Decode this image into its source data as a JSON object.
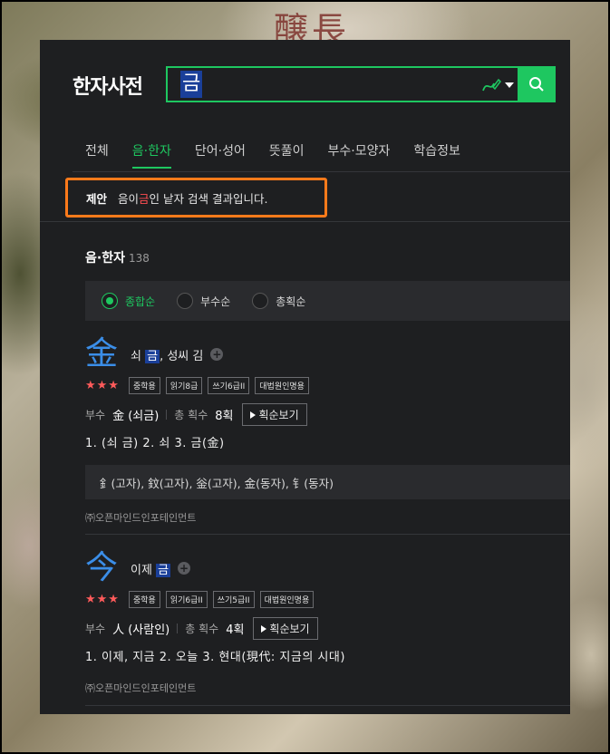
{
  "header": {
    "logo": "한자사전",
    "search_value": "금"
  },
  "tabs": [
    "전체",
    "음·한자",
    "단어·성어",
    "뜻풀이",
    "부수·모양자",
    "학습정보"
  ],
  "suggest": {
    "tag": "제안",
    "text_before": "음이 ",
    "highlight": "금",
    "text_after": "인 낱자 검색 결과입니다."
  },
  "section": {
    "title": "음·한자",
    "count": "138"
  },
  "sort": [
    "종합순",
    "부수순",
    "총획순"
  ],
  "entries": [
    {
      "hanja": "金",
      "meaning_pre": "쇠 ",
      "meaning_hl": "금",
      "meaning_post": ", 성씨 김",
      "stars": "★★★",
      "badges": [
        "중학용",
        "읽기8급",
        "쓰기6급II",
        "대법원인명용"
      ],
      "radical_label": "부수",
      "radical_value": "金 (쇠금)",
      "strokes_label": "총 획수",
      "strokes_value": "8획",
      "stroke_button": "획순보기",
      "definitions": "1. (쇠 금) 2. 쇠 3. 금(金)",
      "variants": "釒(고자), 鈫(고자), 釡(고자), 金(동자), 钅(동자)",
      "source": "㈜오픈마인드인포테인먼트"
    },
    {
      "hanja": "今",
      "meaning_pre": "이제 ",
      "meaning_hl": "금",
      "meaning_post": "",
      "stars": "★★★",
      "badges": [
        "중학용",
        "읽기6급II",
        "쓰기5급II",
        "대법원인명용"
      ],
      "radical_label": "부수",
      "radical_value": "人 (사람인)",
      "strokes_label": "총 획수",
      "strokes_value": "4획",
      "stroke_button": "획순보기",
      "definitions": "1. 이제, 지금 2. 오늘 3. 현대(現代: 지금의 시대)",
      "source": "㈜오픈마인드인포테인먼트"
    }
  ],
  "colors": {
    "accent": "#1ec760",
    "hanja": "#3b8ee8",
    "highlight_bg": "#1a3f99",
    "suggest_border": "#ff7a1a",
    "stars": "#ff5b5b"
  }
}
